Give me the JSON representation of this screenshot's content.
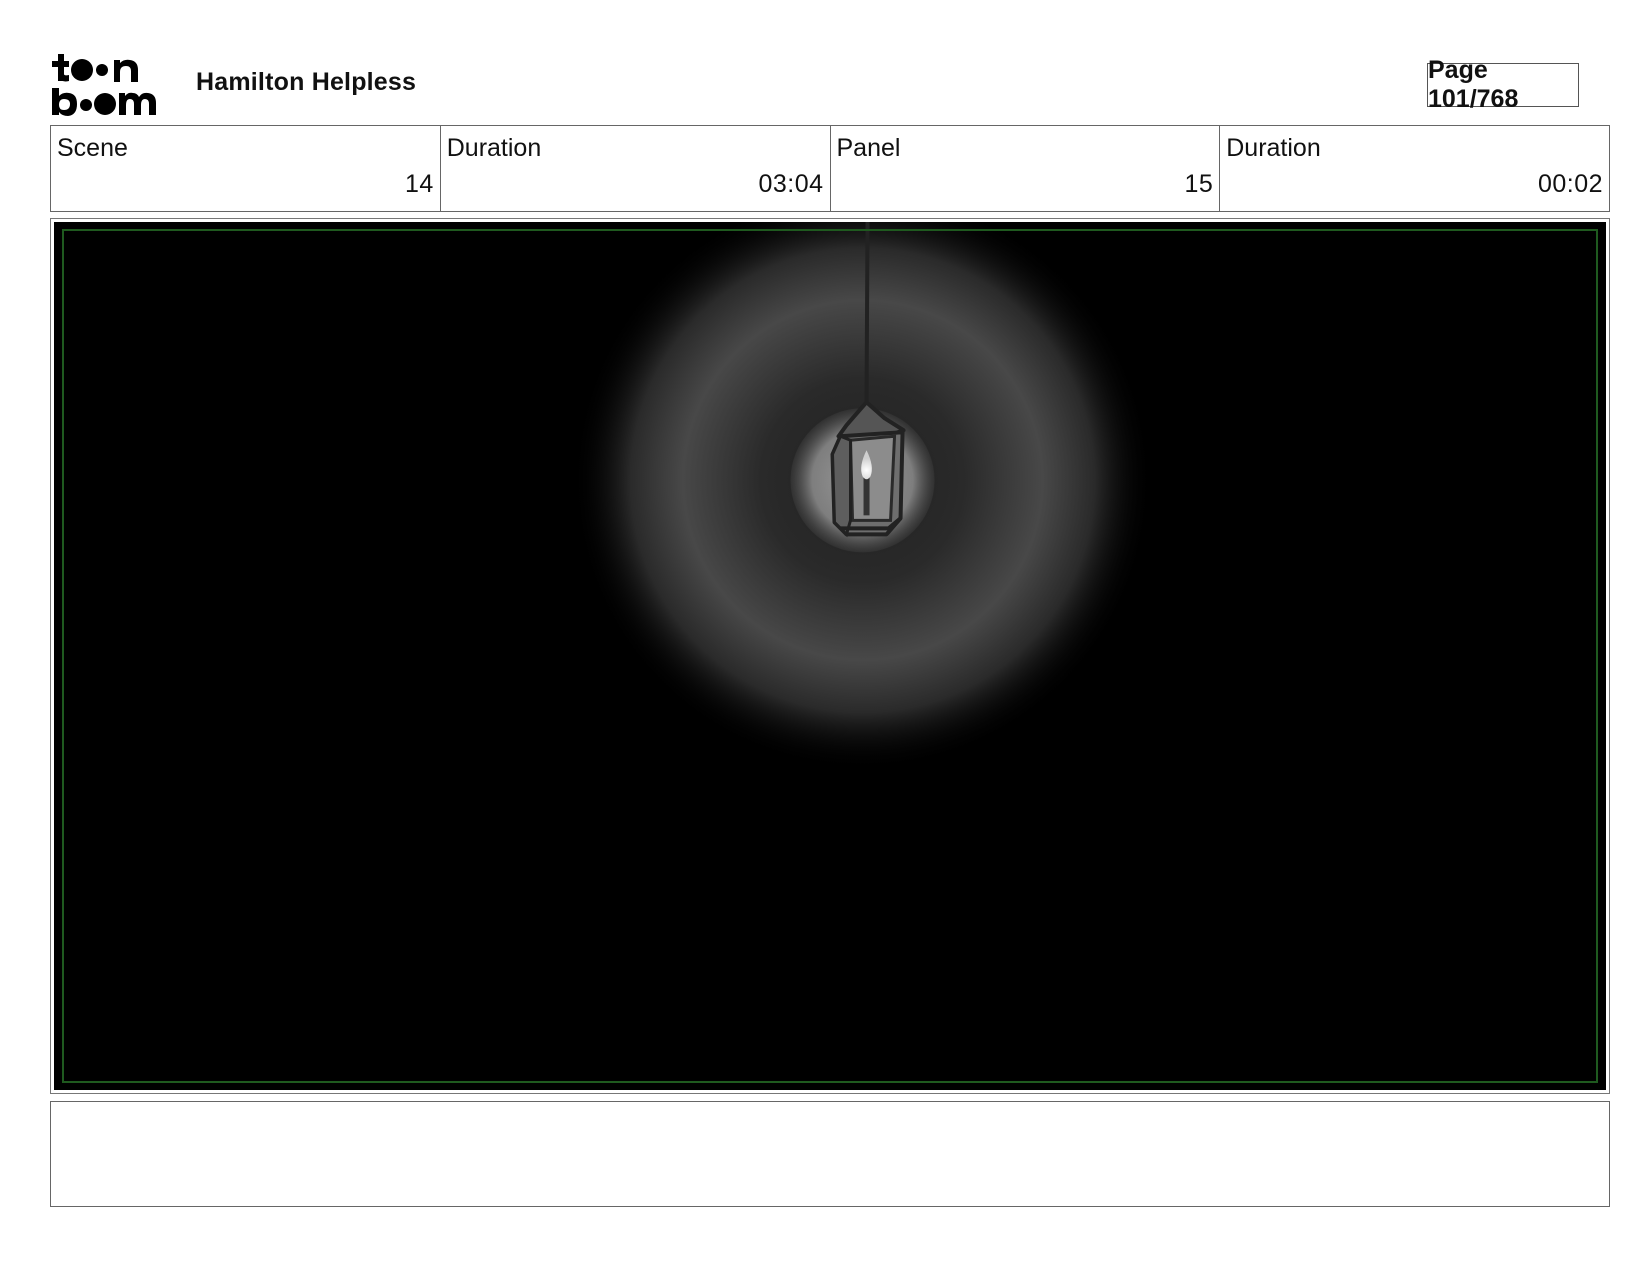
{
  "header": {
    "logo_text": "toonboom",
    "title": "Hamilton Helpless",
    "page_label": "Page 101/768"
  },
  "info": {
    "scene_label": "Scene",
    "scene_value": "14",
    "scene_duration_label": "Duration",
    "scene_duration_value": "03:04",
    "panel_label": "Panel",
    "panel_value": "15",
    "panel_duration_label": "Duration",
    "panel_duration_value": "00:02"
  },
  "notes": {
    "text": ""
  },
  "colors": {
    "panel_background": "#000000",
    "safe_frame": "#1f5a1f",
    "glow": "#8a8a8a"
  }
}
